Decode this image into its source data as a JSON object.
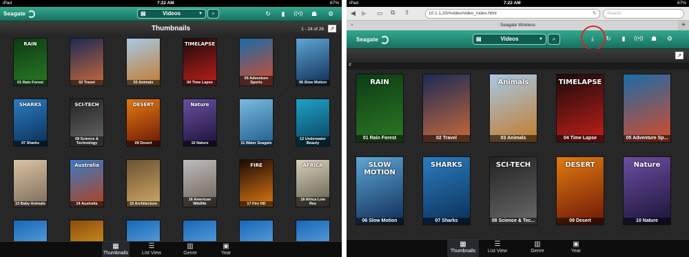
{
  "left": {
    "status": {
      "carrier": "iPad",
      "time": "7:22 AM",
      "battery": "67%"
    },
    "logo": "Seagate",
    "section": "Videos",
    "title": "Thumbnails",
    "count": "1 - 24 of 26",
    "videos": [
      {
        "label": "01 Rain Forest",
        "word": "RAIN",
        "c1": "#0c3b14",
        "c2": "#2b7a24"
      },
      {
        "label": "02 Travel",
        "word": "",
        "c1": "#1c2a55",
        "c2": "#c96a3a"
      },
      {
        "label": "03 Animals",
        "word": "",
        "c1": "#a7c8e6",
        "c2": "#c27b2a"
      },
      {
        "label": "04 Time Lapse",
        "word": "TIMELAPSE",
        "c1": "#1a0b0b",
        "c2": "#c21f1a"
      },
      {
        "label": "05 Adventure Sports",
        "word": "",
        "c1": "#1b6ba8",
        "c2": "#d84a28"
      },
      {
        "label": "06 Slow Motion",
        "word": "",
        "c1": "#5ea6d6",
        "c2": "#0f2b54"
      },
      {
        "label": "07 Sharks",
        "word": "SHARKS",
        "c1": "#2b7cc2",
        "c2": "#0a2f55"
      },
      {
        "label": "08 Science & Technology",
        "word": "SCI-TECH",
        "c1": "#222",
        "c2": "#6a6a6a"
      },
      {
        "label": "09 Desert",
        "word": "DESERT",
        "c1": "#e37a10",
        "c2": "#6b1606"
      },
      {
        "label": "10 Nature",
        "word": "Nature",
        "c1": "#6a4fa0",
        "c2": "#1b1238"
      },
      {
        "label": "11 Water Seagate",
        "word": "",
        "c1": "#7ab9df",
        "c2": "#1d5d8c"
      },
      {
        "label": "12 Underwater Beauty",
        "word": "",
        "c1": "#1ea2c6",
        "c2": "#0b3e5c"
      },
      {
        "label": "13 Baby Animals",
        "word": "",
        "c1": "#d9c3a3",
        "c2": "#7c6a5a"
      },
      {
        "label": "14 Australia",
        "word": "Australia",
        "c1": "#3a7bc8",
        "c2": "#b3411b"
      },
      {
        "label": "15 Architecture",
        "word": "",
        "c1": "#6a5232",
        "c2": "#d3a867"
      },
      {
        "label": "16 American Wildlife",
        "word": "",
        "c1": "#bdbdbd",
        "c2": "#6b5e52"
      },
      {
        "label": "17 Fire HD",
        "word": "FIRE",
        "c1": "#1a0a05",
        "c2": "#e07a12"
      },
      {
        "label": "18 Africa Low Res",
        "word": "AFRICA",
        "c1": "#d9d1bb",
        "c2": "#5d5a4a"
      },
      {
        "label": "",
        "word": "",
        "c1": "#1766b8",
        "c2": "#7fc0ea"
      },
      {
        "label": "",
        "word": "",
        "c1": "#8a4d0a",
        "c2": "#f2b12d"
      },
      {
        "label": "",
        "word": "",
        "c1": "#1766b8",
        "c2": "#7fc0ea"
      },
      {
        "label": "",
        "word": "",
        "c1": "#1766b8",
        "c2": "#7fc0ea"
      },
      {
        "label": "",
        "word": "",
        "c1": "#1766b8",
        "c2": "#7fc0ea"
      },
      {
        "label": "",
        "word": "",
        "c1": "#1766b8",
        "c2": "#7fc0ea"
      }
    ],
    "tabs": [
      "Thumbnails",
      "List View",
      "Genre",
      "Year"
    ]
  },
  "right": {
    "status": {
      "carrier": "iPad",
      "time": "7:22 AM",
      "battery": "67%"
    },
    "url": "10.1.1.20/#video/video_index.html",
    "search_placeholder": "Search",
    "page_title": "Seagate Wireless",
    "logo": "Seagate",
    "section": "Videos",
    "hash": "#",
    "videos": [
      {
        "label": "01 Rain Forest",
        "word": "RAIN",
        "c1": "#0c3b14",
        "c2": "#2b7a24"
      },
      {
        "label": "02 Travel",
        "word": "",
        "c1": "#1c2a55",
        "c2": "#c96a3a"
      },
      {
        "label": "03 Animals",
        "word": "Animals",
        "c1": "#a7c8e6",
        "c2": "#c27b2a"
      },
      {
        "label": "04 Time Lapse",
        "word": "TIMELAPSE",
        "c1": "#1a0b0b",
        "c2": "#c21f1a"
      },
      {
        "label": "05 Adventure Sp...",
        "word": "",
        "c1": "#1b6ba8",
        "c2": "#d84a28"
      },
      {
        "label": "06 Slow Motion",
        "word": "SLOW MOTION",
        "c1": "#5ea6d6",
        "c2": "#0f2b54"
      },
      {
        "label": "07 Sharks",
        "word": "SHARKS",
        "c1": "#2b7cc2",
        "c2": "#0a2f55"
      },
      {
        "label": "08 Science & Tec...",
        "word": "SCI-TECH",
        "c1": "#222",
        "c2": "#6a6a6a"
      },
      {
        "label": "09 Desert",
        "word": "DESERT",
        "c1": "#e37a10",
        "c2": "#6b1606"
      },
      {
        "label": "10 Nature",
        "word": "Nature",
        "c1": "#6a4fa0",
        "c2": "#1b1238"
      }
    ],
    "tabs": [
      "Thumbnails",
      "List View",
      "Genre",
      "Year"
    ]
  }
}
